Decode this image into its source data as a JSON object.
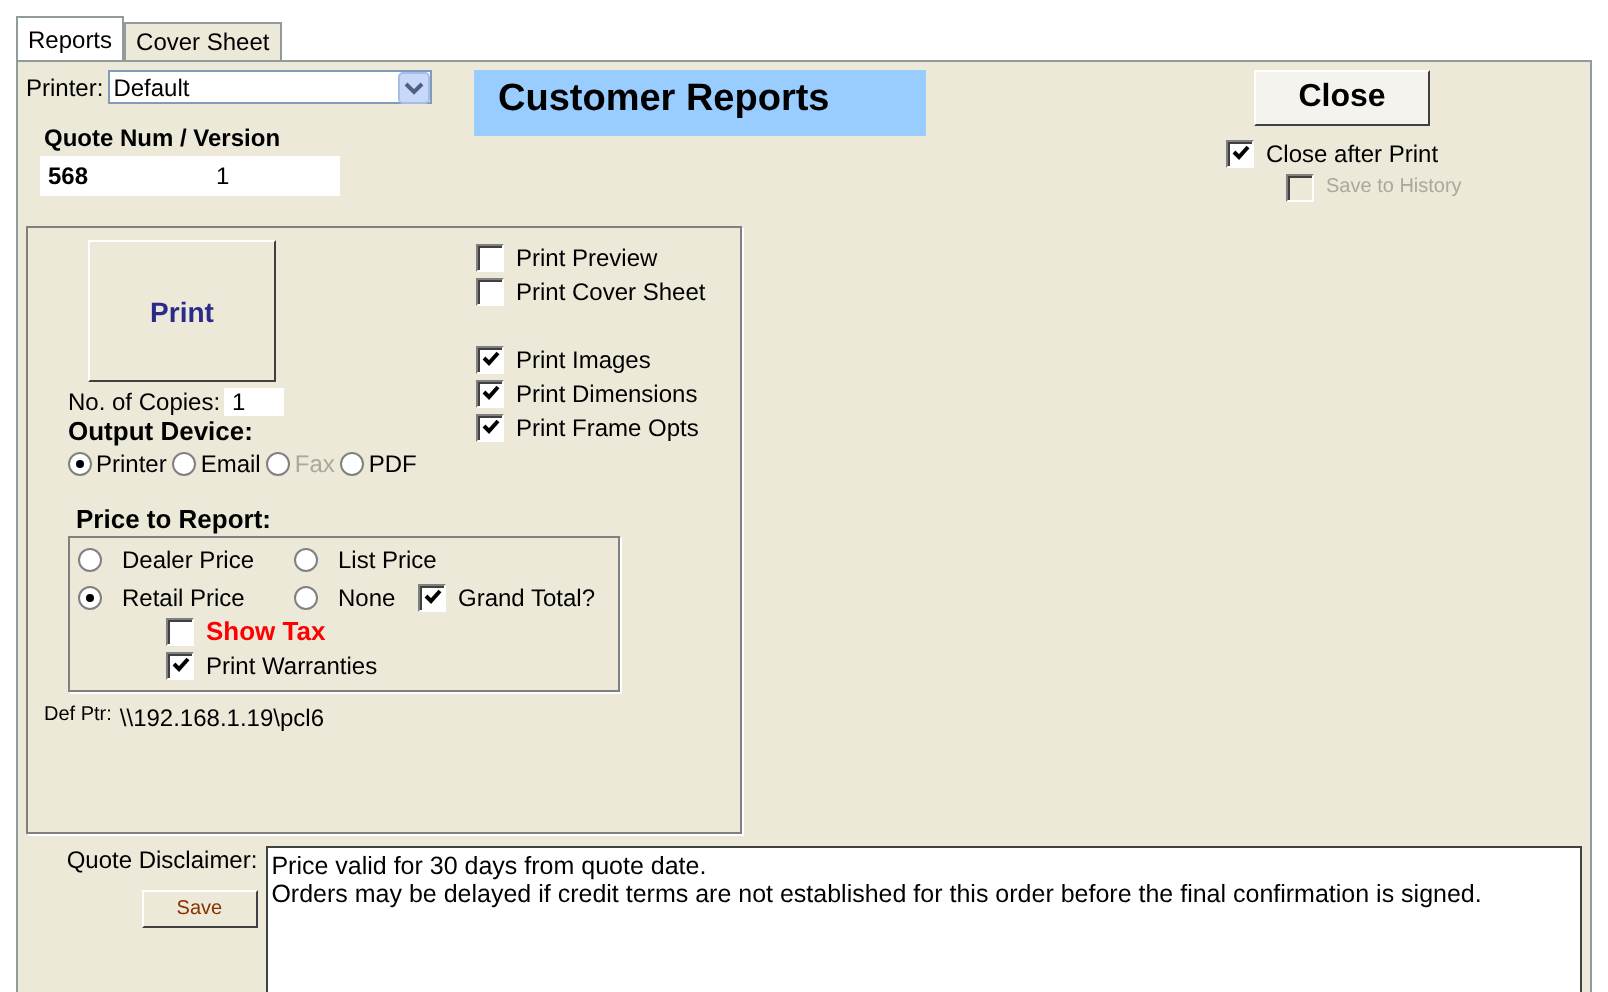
{
  "tabs": [
    {
      "label": "Reports",
      "selected": true
    },
    {
      "label": "Cover Sheet",
      "selected": false
    }
  ],
  "printer": {
    "label": "Printer:",
    "value": "Default"
  },
  "title": "Customer Reports",
  "quote": {
    "label": "Quote Num / Version",
    "number": "568",
    "version": "1"
  },
  "close_button": "Close",
  "close_options": [
    {
      "label": "Close after Print",
      "checked": true,
      "disabled": false
    },
    {
      "label": "Save to History",
      "checked": false,
      "disabled": true
    }
  ],
  "print_button": "Print",
  "copies": {
    "label": "No. of Copies:",
    "value": "1"
  },
  "output_device": {
    "label": "Output Device:",
    "options": [
      {
        "label": "Printer",
        "selected": true,
        "disabled": false
      },
      {
        "label": "Email",
        "selected": false,
        "disabled": false
      },
      {
        "label": "Fax",
        "selected": false,
        "disabled": true
      },
      {
        "label": "PDF",
        "selected": false,
        "disabled": false
      }
    ]
  },
  "print_option_groups": [
    {
      "options": [
        {
          "label": "Print Preview",
          "checked": false
        },
        {
          "label": "Print Cover Sheet",
          "checked": false
        }
      ]
    },
    {
      "options": [
        {
          "label": "Print Images",
          "checked": true
        },
        {
          "label": "Print Dimensions",
          "checked": true
        },
        {
          "label": "Print Frame Opts",
          "checked": true
        }
      ]
    }
  ],
  "price": {
    "label": "Price to Report:",
    "options": [
      {
        "label": "Dealer Price",
        "selected": false
      },
      {
        "label": "List Price",
        "selected": false
      },
      {
        "label": "Retail Price",
        "selected": true
      },
      {
        "label": "None",
        "selected": false
      }
    ],
    "grand_total": {
      "label": "Grand Total?",
      "checked": true
    },
    "show_tax": {
      "label": "Show Tax",
      "checked": false
    },
    "print_warranties": {
      "label": "Print Warranties",
      "checked": true
    }
  },
  "default_printer": {
    "label": "Def Ptr:",
    "value": "\\\\192.168.1.19\\pcl6"
  },
  "disclaimer": {
    "label": "Quote Disclaimer:",
    "save_button": "Save",
    "text": "Price valid for 30 days from quote date.\nOrders may be delayed if credit terms are not established for this order before the final confirmation is signed."
  }
}
